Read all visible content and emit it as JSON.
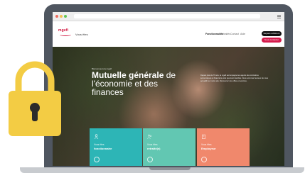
{
  "site": {
    "logo": "mgefi",
    "slogan": "Vous êtes",
    "nav": [
      "Fonctionnaires",
      "Retraités",
      "Contact",
      "Aide"
    ],
    "account_button": "Espace adhérent",
    "join_button": "Nous contacter"
  },
  "hero": {
    "eyebrow": "Bienvenue à la mgefi",
    "title_bold": "Mutuelle générale",
    "title_rest": "de l'économie et des finances",
    "description": "Depuis plus de 70 ans, la mgefi accompagne les agents des ministères économiques et financiers ainsi que leurs familles. Nous sommes heureux de vous accueillir sur notre site. Découvrez nos offres et services."
  },
  "cards": [
    {
      "icon": "person-icon",
      "small": "Vous êtes",
      "strong": "fonctionnaire"
    },
    {
      "icon": "family-icon",
      "small": "Vous êtes",
      "strong": "retraité(e)"
    },
    {
      "icon": "building-icon",
      "small": "Vous êtes",
      "strong": "Employeur"
    }
  ],
  "colors": {
    "lock": "#f3cc44",
    "brand_red": "#d51b4c",
    "card_teal": "#2db5b6",
    "card_mint": "#62c7b2",
    "card_coral": "#f0886c"
  }
}
